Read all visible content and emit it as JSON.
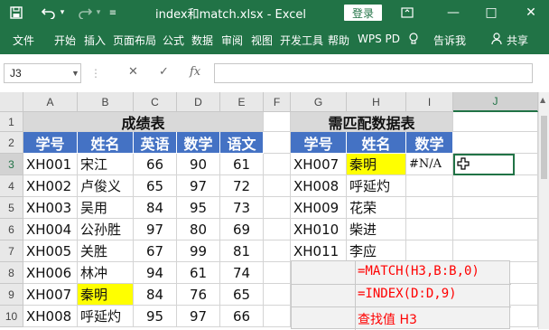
{
  "titlebar": {
    "title": "index和match.xlsx  -  Excel",
    "login_label": "登录",
    "minimize_icon": "—",
    "restore_icon": "□",
    "close_icon": "✕"
  },
  "ribbon": {
    "items": [
      "文件",
      "开始",
      "插入",
      "页面布局",
      "公式",
      "数据",
      "审阅",
      "视图",
      "开发工具",
      "帮助",
      "WPS PD",
      "告诉我",
      "共享"
    ]
  },
  "formula_bar": {
    "name_box": "J3",
    "value": ""
  },
  "columns": [
    "A",
    "B",
    "C",
    "D",
    "E",
    "F",
    "G",
    "H",
    "I",
    "J"
  ],
  "rows": [
    "1",
    "2",
    "3",
    "4",
    "5",
    "6",
    "7",
    "8",
    "9",
    "10"
  ],
  "left_table": {
    "title": "成绩表",
    "headers": [
      "学号",
      "姓名",
      "英语",
      "数学",
      "语文"
    ],
    "rows": [
      [
        "XH001",
        "宋江",
        "66",
        "90",
        "61"
      ],
      [
        "XH002",
        "卢俊义",
        "65",
        "97",
        "72"
      ],
      [
        "XH003",
        "吴用",
        "84",
        "95",
        "73"
      ],
      [
        "XH004",
        "公孙胜",
        "97",
        "80",
        "69"
      ],
      [
        "XH005",
        "关胜",
        "67",
        "99",
        "81"
      ],
      [
        "XH006",
        "林冲",
        "94",
        "61",
        "74"
      ],
      [
        "XH007",
        "秦明",
        "84",
        "76",
        "65"
      ],
      [
        "XH008",
        "呼延灼",
        "95",
        "97",
        "66"
      ]
    ]
  },
  "right_table": {
    "title": "需匹配数据表",
    "headers": [
      "学号",
      "姓名",
      "数学"
    ],
    "rows": [
      [
        "XH007",
        "秦明",
        "#N/A"
      ],
      [
        "XH008",
        "呼延灼",
        ""
      ],
      [
        "XH009",
        "花荣",
        ""
      ],
      [
        "XH010",
        "柴进",
        ""
      ],
      [
        "XH011",
        "李应",
        ""
      ]
    ]
  },
  "formulas": [
    "=MATCH(H3,B:B,0)",
    "=INDEX(D:D,9)",
    "查找值 H3"
  ],
  "colors": {
    "excel_green": "#217346",
    "header_blue": "#4472c4",
    "highlight_yellow": "#ffff00",
    "formula_red": "#ff0000"
  }
}
